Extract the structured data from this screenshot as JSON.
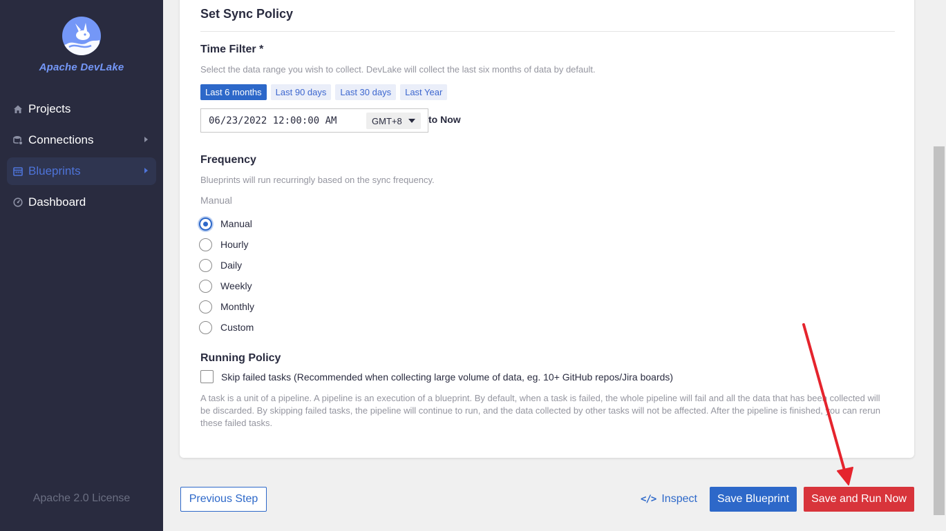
{
  "sidebar": {
    "brand": "Apache DevLake",
    "items": [
      {
        "label": "Projects",
        "icon": "home-icon"
      },
      {
        "label": "Connections",
        "icon": "database-icon"
      },
      {
        "label": "Blueprints",
        "icon": "calendar-icon"
      },
      {
        "label": "Dashboard",
        "icon": "dashboard-icon"
      }
    ],
    "license": "Apache 2.0 License"
  },
  "sync_policy": {
    "title": "Set Sync Policy",
    "time_filter": {
      "title": "Time Filter *",
      "help": "Select the data range you wish to collect. DevLake will collect the last six months of data by default.",
      "presets": [
        "Last 6 months",
        "Last 90 days",
        "Last 30 days",
        "Last Year"
      ],
      "selected_preset": "Last 6 months",
      "start_date": "06/23/2022 12:00:00 AM",
      "timezone": "GMT+8",
      "to_label": "to Now"
    },
    "frequency": {
      "title": "Frequency",
      "help": "Blueprints will run recurringly based on the sync frequency.",
      "current": "Manual",
      "options": [
        "Manual",
        "Hourly",
        "Daily",
        "Weekly",
        "Monthly",
        "Custom"
      ],
      "selected": "Manual"
    },
    "running_policy": {
      "title": "Running Policy",
      "skip_label": "Skip failed tasks (Recommended when collecting large volume of data, eg. 10+ GitHub repos/Jira boards)",
      "skip_checked": false,
      "description": "A task is a unit of a pipeline. A pipeline is an execution of a blueprint. By default, when a task is failed, the whole pipeline will fail and all the data that has been collected will be discarded. By skipping failed tasks, the pipeline will continue to run, and the data collected by other tasks will not be affected. After the pipeline is finished, you can rerun these failed tasks."
    }
  },
  "footer": {
    "previous": "Previous Step",
    "inspect": "Inspect",
    "save": "Save Blueprint",
    "save_run": "Save and Run Now"
  },
  "colors": {
    "sidebar_bg": "#292b3f",
    "primary": "#2d68c9",
    "danger": "#d8343b",
    "annotation_arrow": "#e5242d"
  }
}
